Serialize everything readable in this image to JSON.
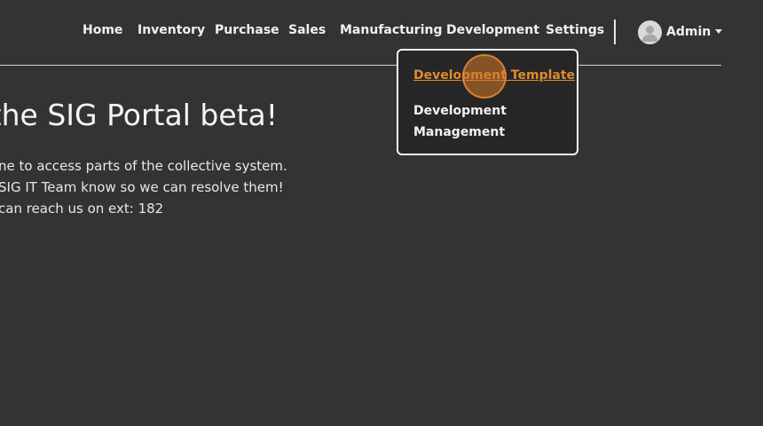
{
  "nav": {
    "links": [
      "Home",
      "Inventory",
      "Purchase",
      "Sales",
      "Manufacturing",
      "Development",
      "Settings"
    ],
    "user": {
      "name": "Admin"
    }
  },
  "main": {
    "title": "o the SIG Portal beta!",
    "lines": [
      "ne to access parts of the collective system.",
      "SIG IT Team know so we can resolve them!",
      "can reach us on ext: 182"
    ]
  },
  "dropdown": {
    "items": [
      "Development Template",
      "Development Management"
    ]
  },
  "colors": {
    "background": "#333333",
    "accent": "#e08a2e",
    "dropdown_bg": "#262626"
  }
}
